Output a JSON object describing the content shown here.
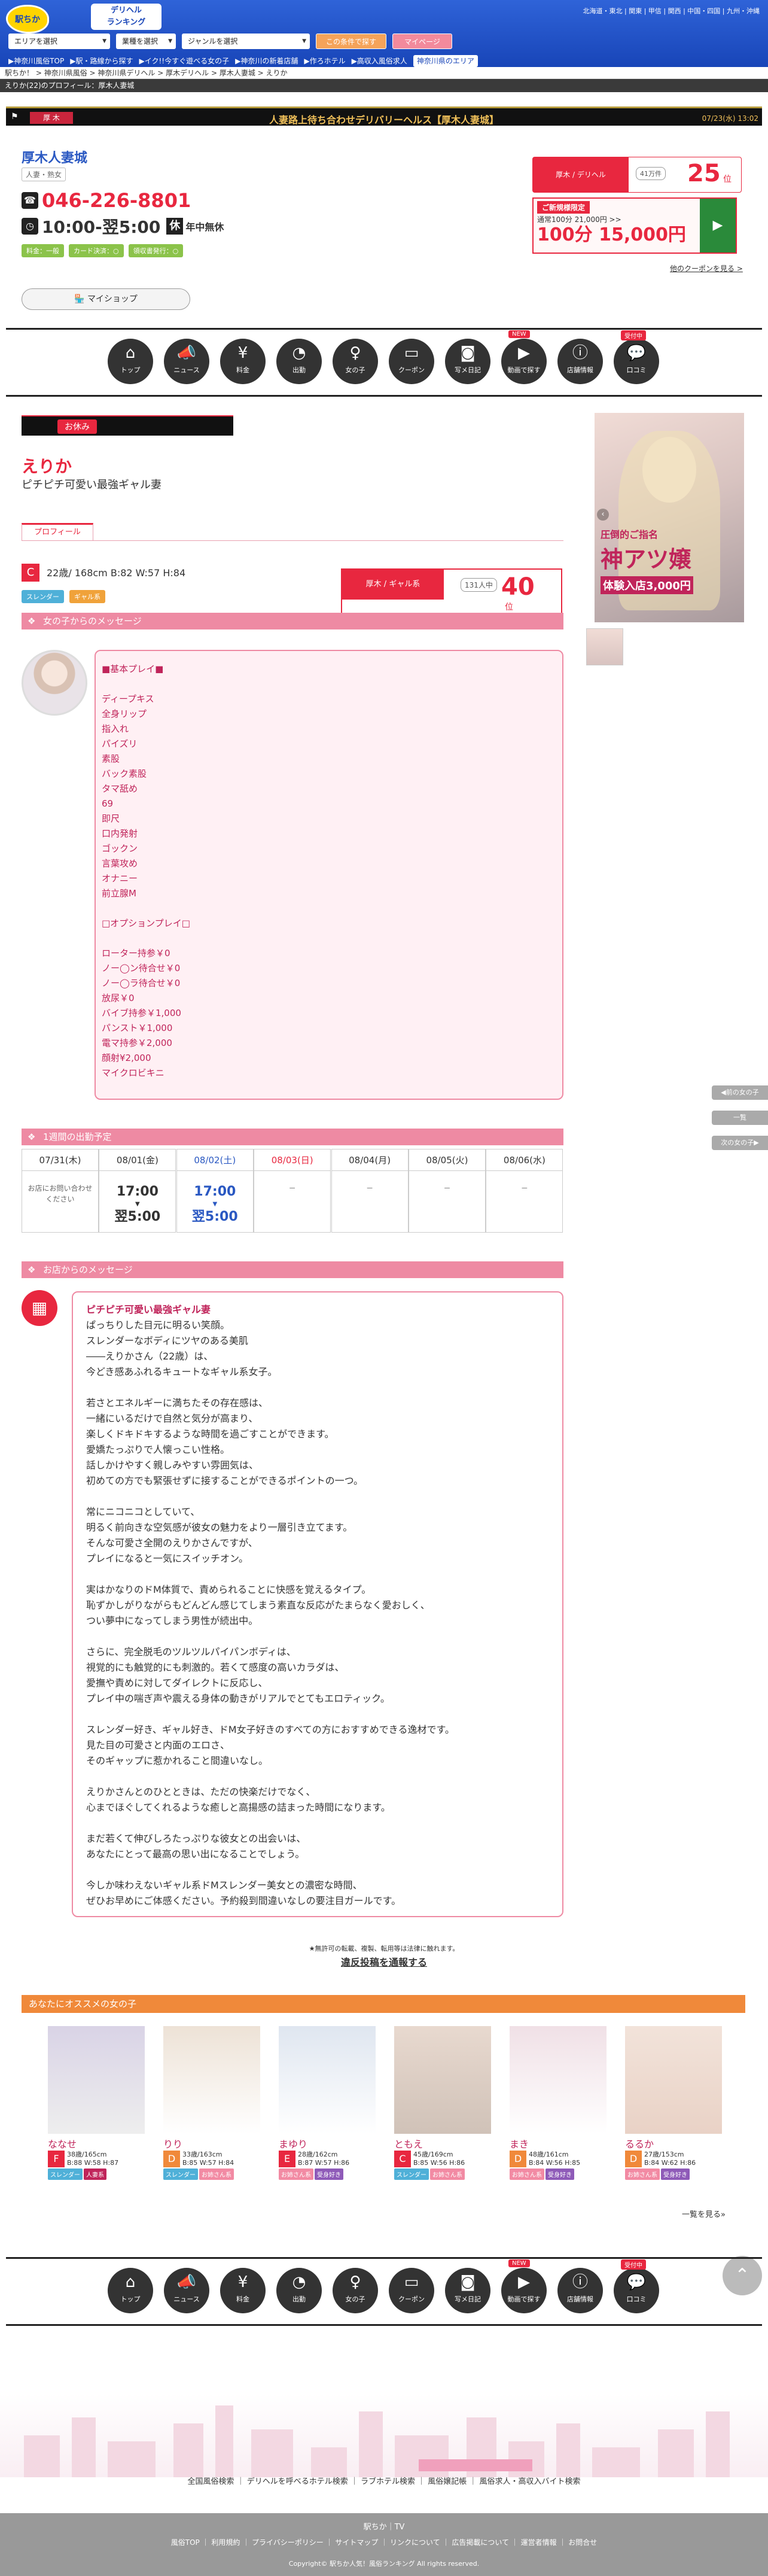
{
  "header": {
    "site_name": "駅ちか人気!",
    "rank_badge_top": "デリヘル",
    "rank_badge_bottom": "ランキング",
    "regions": "北海道・東北 | 関東 | 甲信 | 関西 | 中国・四国 | 九州・沖縄",
    "select_area": "エリアを選択",
    "select_type": "業種を選択",
    "select_genre": "ジャンルを選択",
    "search_button": "この条件で探す",
    "mypage_button": "マイページ",
    "subnav": [
      "▶神奈川風俗TOP",
      "▶駅・路線から探す",
      "▶イク!!今すぐ遊べる女の子",
      "▶神奈川の新着店舗",
      "▶作ろホテル",
      "▶高収入風俗求人"
    ],
    "area_tag": "神奈川県のエリア"
  },
  "breadcrumb": [
    "駅ちか！",
    "神奈川県風俗",
    "神奈川県デリヘル",
    "厚木デリヘル",
    "厚木人妻城",
    "えりか"
  ],
  "page_heading": "えりか(22)のプロフィール：厚木人妻城",
  "store_bar": {
    "region": "厚 木",
    "title": "人妻路上待ち合わせデリバリーヘルス【厚木人妻城】",
    "date": "07/23(水) 13:02"
  },
  "shop": {
    "name": "厚木人妻城",
    "type": "人妻・熟女",
    "tel": "046-226-8801",
    "hours": "10:00-翌5:00",
    "holiday_icon": "休",
    "holiday": "年中無休",
    "tags": [
      "料金：一般",
      "カード決済：○",
      "領収書発行：○"
    ],
    "myshop": "マイショップ",
    "rank": {
      "label": "厚木 / デリヘル",
      "count": "41万件",
      "num": "25",
      "unit": "位"
    },
    "coupon": {
      "head": "ご新規様限定",
      "text": "通常100分 21,000円 >>",
      "price": "100分 15,000円"
    },
    "coupon_more": "他のクーポンを見る >"
  },
  "nav": [
    {
      "icon": "⌂",
      "label": "トップ"
    },
    {
      "icon": "📣",
      "label": "ニュース"
    },
    {
      "icon": "¥",
      "label": "料金"
    },
    {
      "icon": "◔",
      "label": "出勤"
    },
    {
      "icon": "♀",
      "label": "女の子"
    },
    {
      "icon": "▭",
      "label": "クーポン"
    },
    {
      "icon": "◙",
      "label": "写メ日記",
      "badge": ""
    },
    {
      "icon": "▶",
      "label": "動画で探す",
      "badge": "NEW"
    },
    {
      "icon": "ⓘ",
      "label": "店舗情報"
    },
    {
      "icon": "💬",
      "label": "口コミ",
      "badge": "受付中"
    }
  ],
  "girl": {
    "status": "お休み",
    "name": "えりか",
    "catch": "ピチピチ可愛い最強ギャル妻",
    "tab": "プロフィール",
    "cup": "C",
    "spec": "22歳/ 168cm B:82 W:57 H:84",
    "tags": [
      "スレンダー",
      "ギャル系"
    ],
    "rank": {
      "label": "厚木 / ギャル系",
      "count": "131人中",
      "num": "40",
      "unit": "位"
    },
    "msg_header": "女の子からのメッセージ",
    "msg": "■基本プレイ■\n\nディープキス\n全身リップ\n指入れ\nパイズリ\n素股\nバック素股\nタマ舐め\n69\n即尺\n口内発射\nゴックン\n言葉攻め\nオナニー\n前立腺M\n\n□オプションプレイ□\n\nローター持参￥0\nノー◯ン待合せ￥0\nノー◯ラ待合せ￥0\n放尿￥0\nバイブ持参￥1,000\nパンスト￥1,000\n電マ持参￥2,000\n顔射¥2,000\nマイクロビキニ"
  },
  "schedule": {
    "header": "1週間の出勤予定",
    "days": [
      {
        "date": "07/31(木)",
        "start": "",
        "end": "",
        "note": "お店にお問い合わせ\nください"
      },
      {
        "date": "08/01(金)",
        "start": "17:00",
        "end": "翌5:00",
        "note": ""
      },
      {
        "date": "08/02(土)",
        "start": "17:00",
        "end": "翌5:00",
        "note": ""
      },
      {
        "date": "08/03(日)",
        "start": "",
        "end": "",
        "note": "－"
      },
      {
        "date": "08/04(月)",
        "start": "",
        "end": "",
        "note": "－"
      },
      {
        "date": "08/05(火)",
        "start": "",
        "end": "",
        "note": "－"
      },
      {
        "date": "08/06(水)",
        "start": "",
        "end": "",
        "note": "－"
      }
    ]
  },
  "shop_msg": {
    "header": "お店からのメッセージ",
    "title": "ピチピチ可愛い最強ギャル妻",
    "body": "ぱっちりした目元に明るい笑顔。\nスレンダーなボディにツヤのある美肌\n――えりかさん（22歳）は、\n今どき感あふれるキュートなギャル系女子。\n\n若さとエネルギーに満ちたその存在感は、\n一緒にいるだけで自然と気分が高まり、\n楽しくドキドキするような時間を過ごすことができます。\n愛嬌たっぷりで人懐っこい性格。\n話しかけやすく親しみやすい雰囲気は、\n初めての方でも緊張せずに接することができるポイントの一つ。\n\n常にニコニコとしていて、\n明るく前向きな空気感が彼女の魅力をより一層引き立てます。\nそんな可愛さ全開のえりかさんですが、\nプレイになると一気にスイッチオン。\n\n実はかなりのドM体質で、責められることに快感を覚えるタイプ。\n恥ずかしがりながらもどんどん感じてしまう素直な反応がたまらなく愛おしく、\nつい夢中になってしまう男性が続出中。\n\nさらに、完全脱毛のツルツルパイパンボディは、\n視覚的にも触覚的にも刺激的。若くて感度の高いカラダは、\n愛撫や責めに対してダイレクトに反応し、\nプレイ中の喘ぎ声や震える身体の動きがリアルでとてもエロティック。\n\nスレンダー好き、ギャル好き、ドM女子好きのすべての方におすすめできる逸材です。\n見た目の可愛さと内面のエロさ、\nそのギャップに惹かれること間違いなし。\n\nえりかさんとのひとときは、ただの快楽だけでなく、\n心までほぐしてくれるような癒しと高揚感の詰まった時間になります。\n\nまだ若くて伸びしろたっぷりな彼女との出会いは、\nあなたにとって最高の思い出になることでしょう。\n\n今しか味わえないギャル系ドMスレンダー美女との濃密な時間、\nぜひお早めにご体感ください。予約殺到間違いなしの要注目ガールです。"
  },
  "report": {
    "note": "★無許可の転載、複製、転用等は法律に触れます。",
    "link": "違反投稿を通報する"
  },
  "recommend": {
    "header": "あなたにオススメの女の子",
    "more": "一覧を見る»",
    "girls": [
      {
        "name": "ななせ",
        "cup": "F",
        "spec1": "38歳/165cm",
        "spec2": "B:88 W:58 H:87",
        "tags": [
          "スレンダー",
          "人妻系"
        ],
        "cupcolor": "#e8273f"
      },
      {
        "name": "りり",
        "cup": "D",
        "spec1": "33歳/163cm",
        "spec2": "B:85 W:57 H:84",
        "tags": [
          "スレンダー",
          "お姉さん系"
        ],
        "cupcolor": "#f0893a"
      },
      {
        "name": "まゆり",
        "cup": "E",
        "spec1": "28歳/162cm",
        "spec2": "B:87 W:57 H:86",
        "tags": [
          "お姉さん系",
          "受身好き"
        ],
        "cupcolor": "#e8273f"
      },
      {
        "name": "ともえ",
        "cup": "C",
        "spec1": "45歳/169cm",
        "spec2": "B:85 W:56 H:86",
        "tags": [
          "スレンダー",
          "お姉さん系"
        ],
        "cupcolor": "#e8273f"
      },
      {
        "name": "まき",
        "cup": "D",
        "spec1": "48歳/161cm",
        "spec2": "B:84 W:56 H:85",
        "tags": [
          "お姉さん系",
          "受身好き"
        ],
        "cupcolor": "#f0893a"
      },
      {
        "name": "るるか",
        "cup": "D",
        "spec1": "27歳/153cm",
        "spec2": "B:84 W:62 H:86",
        "tags": [
          "お姉さん系",
          "受身好き"
        ],
        "cupcolor": "#f0893a"
      }
    ]
  },
  "side": {
    "prev": "◀前の女の子",
    "list": "一覧",
    "next": "次の女の子▶"
  },
  "banner": {
    "line1": "圧倒的ご指名",
    "line2": "神アツ嬢",
    "line3": "体験入店3,000円"
  },
  "footer": {
    "links": "全国風俗検索 ｜ デリヘルを呼べるホテル検索 ｜ ラブホテル検索 ｜ 風俗嬢記帳 ｜ 風俗求人・高収入バイト検索",
    "brand": "駅ちか｜TV",
    "bottom": "風俗TOP ｜ 利用規約 ｜ プライバシーポリシー ｜ サイトマップ ｜ リンクについて ｜ 広告掲載について ｜ 運営者情報 ｜ お問合せ",
    "copy": "Copyright© 駅ちか人気！風俗ランキング All rights reserved."
  }
}
